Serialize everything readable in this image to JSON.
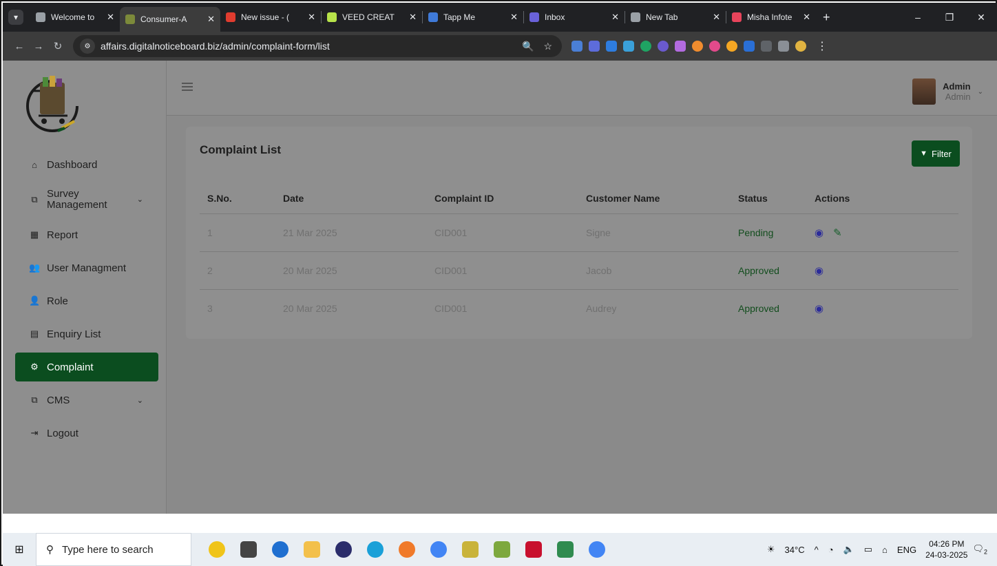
{
  "browser": {
    "tabs": [
      {
        "title": "Welcome to",
        "color": "#9aa0a6",
        "active": false
      },
      {
        "title": "Consumer-A",
        "color": "#7c8a3a",
        "active": true
      },
      {
        "title": "New issue - (",
        "color": "#e03c2f",
        "active": false
      },
      {
        "title": "VEED CREAT",
        "color": "#b7e34a",
        "active": false
      },
      {
        "title": "Tapp Me",
        "color": "#3f7ad8",
        "active": false
      },
      {
        "title": "Inbox",
        "color": "#6a62d9",
        "active": false
      },
      {
        "title": "New Tab",
        "color": "#9aa0a6",
        "active": false
      },
      {
        "title": "Misha Infote",
        "color": "#e8445b",
        "active": false
      }
    ],
    "url": "affairs.digitalnoticeboard.biz/admin/complaint-form/list"
  },
  "sidebar": {
    "items": [
      {
        "label": "Dashboard",
        "icon": "home-icon",
        "glyph": "⌂"
      },
      {
        "label": "Survey Management",
        "icon": "copy-icon",
        "glyph": "⧉",
        "expandable": true
      },
      {
        "label": "Report",
        "icon": "chart-icon",
        "glyph": "▦"
      },
      {
        "label": "User Managment",
        "icon": "users-icon",
        "glyph": "👥"
      },
      {
        "label": "Role",
        "icon": "user-tie-icon",
        "glyph": "👤"
      },
      {
        "label": "Enquiry List",
        "icon": "id-card-icon",
        "glyph": "▤"
      },
      {
        "label": "Complaint",
        "icon": "gear-icon",
        "glyph": "⚙",
        "active": true
      },
      {
        "label": "CMS",
        "icon": "copy-icon",
        "glyph": "⧉",
        "expandable": true
      },
      {
        "label": "Logout",
        "icon": "sign-out-icon",
        "glyph": "⇥"
      }
    ]
  },
  "header": {
    "user_name": "Admin",
    "user_role": "Admin"
  },
  "main": {
    "title": "Complaint List",
    "filter_label": "Filter",
    "columns": [
      "S.No.",
      "Date",
      "Complaint ID",
      "Customer Name",
      "Status",
      "Actions"
    ],
    "rows": [
      {
        "sno": "1",
        "date": "21 Mar 2025",
        "cid": "CID001",
        "customer": "Signe",
        "status": "Pending",
        "editable": true
      },
      {
        "sno": "2",
        "date": "20 Mar 2025",
        "cid": "CID001",
        "customer": "Jacob",
        "status": "Approved",
        "editable": false
      },
      {
        "sno": "3",
        "date": "20 Mar 2025",
        "cid": "CID001",
        "customer": "Audrey",
        "status": "Approved",
        "editable": false
      }
    ]
  },
  "taskbar": {
    "search_placeholder": "Type here to search",
    "temperature": "34°C",
    "language": "ENG",
    "time": "04:26 PM",
    "date": "24-03-2025",
    "notification_count": "2"
  }
}
